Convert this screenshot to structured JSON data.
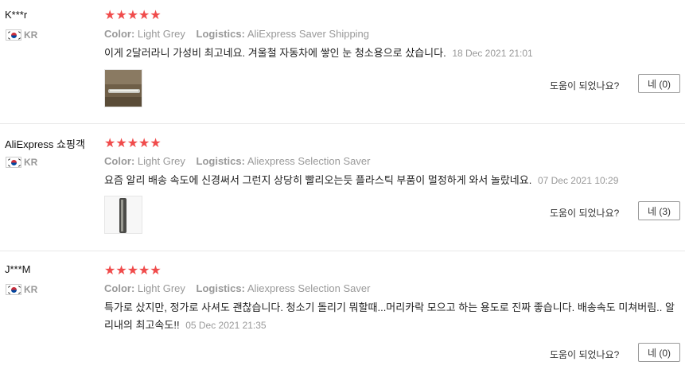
{
  "reviews": [
    {
      "user": "K***r",
      "country": "KR",
      "stars": "★★★★★",
      "color_key": "Color:",
      "color_value": "Light Grey",
      "logistics_key": "Logistics:",
      "logistics_value": "AliExpress Saver Shipping",
      "text": "이게 2달러라니 가성비 최고네요. 겨울철 자동차에 쌓인 눈 청소용으로 샀습니다.",
      "date": "18 Dec 2021 21:01",
      "helpful_question": "도움이 되었나요?",
      "helpful_button": "네 (0)"
    },
    {
      "user": "AliExpress 쇼핑객",
      "country": "KR",
      "stars": "★★★★★",
      "color_key": "Color:",
      "color_value": "Light Grey",
      "logistics_key": "Logistics:",
      "logistics_value": "Aliexpress Selection Saver",
      "text": "요즘 알리 배송 속도에 신경써서 그런지 상당히 빨리오는듯 플라스틱 부품이 멀정하게 와서 놀랐네요.",
      "date": "07 Dec 2021 10:29",
      "helpful_question": "도움이 되었나요?",
      "helpful_button": "네 (3)"
    },
    {
      "user": "J***M",
      "country": "KR",
      "stars": "★★★★★",
      "color_key": "Color:",
      "color_value": "Light Grey",
      "logistics_key": "Logistics:",
      "logistics_value": "Aliexpress Selection Saver",
      "text": "특가로 샀지만, 정가로 사셔도 괜찮습니다. 청소기 돌리기 뭐할때...머리카락 모으고 하는 용도로 진짜 좋습니다. 배송속도 미쳐버림.. 알리내의 최고속도!!",
      "date": "05 Dec 2021 21:35",
      "helpful_question": "도움이 되었나요?",
      "helpful_button": "네 (0)"
    }
  ]
}
